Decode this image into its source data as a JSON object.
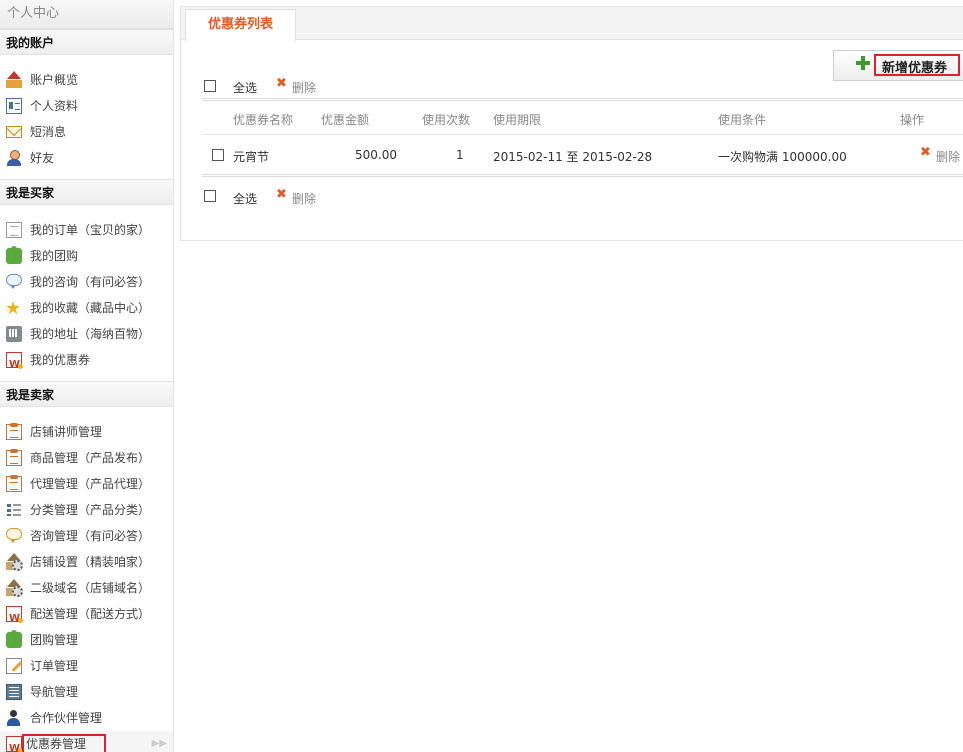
{
  "sidebar": {
    "title": "个人中心",
    "groups": [
      {
        "title": "我的账户",
        "items": [
          {
            "label": "账户概览",
            "icon": "house-icon"
          },
          {
            "label": "个人资料",
            "icon": "id-card-icon"
          },
          {
            "label": "短消息",
            "icon": "mail-icon"
          },
          {
            "label": "好友",
            "icon": "person-icon"
          }
        ]
      },
      {
        "title": "我是买家",
        "items": [
          {
            "label": "我的订单（宝贝的家）",
            "icon": "document-icon"
          },
          {
            "label": "我的团购",
            "icon": "puzzle-icon"
          },
          {
            "label": "我的咨询（有问必答）",
            "icon": "chat-bubble-icon"
          },
          {
            "label": "我的收藏（藏品中心）",
            "icon": "star-icon"
          },
          {
            "label": "我的地址（海纳百物）",
            "icon": "phone-icon"
          },
          {
            "label": "我的优惠券",
            "icon": "coupon-icon"
          }
        ]
      },
      {
        "title": "我是卖家",
        "items": [
          {
            "label": "店铺讲师管理",
            "icon": "clipboard-icon"
          },
          {
            "label": "商品管理（产品发布）",
            "icon": "clipboard-icon"
          },
          {
            "label": "代理管理（产品代理）",
            "icon": "clipboard-icon"
          },
          {
            "label": "分类管理（产品分类）",
            "icon": "list-icon"
          },
          {
            "label": "咨询管理（有问必答）",
            "icon": "chat-bubble-icon"
          },
          {
            "label": "店铺设置（精装咱家）",
            "icon": "house-settings-icon"
          },
          {
            "label": "二级域名（店铺域名）",
            "icon": "house-settings-icon"
          },
          {
            "label": "配送管理（配送方式）",
            "icon": "coupon-icon"
          },
          {
            "label": "团购管理",
            "icon": "puzzle-icon"
          },
          {
            "label": "订单管理",
            "icon": "edit-icon"
          },
          {
            "label": "导航管理",
            "icon": "grid-icon"
          },
          {
            "label": "合作伙伴管理",
            "icon": "partners-icon"
          },
          {
            "label": "优惠券管理",
            "icon": "coupon-icon",
            "active": true
          }
        ]
      }
    ]
  },
  "main": {
    "tab": "优惠券列表",
    "add_button": "新增优惠券",
    "select_all": "全选",
    "delete": "删除",
    "columns": [
      "优惠券名称",
      "优惠金额",
      "使用次数",
      "使用期限",
      "使用条件",
      "操作"
    ],
    "rows": [
      {
        "name": "元宵节",
        "amount": "500.00",
        "uses": "1",
        "period": "2015-02-11 至 2015-02-28",
        "condition": "一次购物满 100000.00",
        "action": "删除"
      }
    ]
  },
  "colors": {
    "accent": "#e65a20",
    "highlight_border": "#d9232a",
    "add_icon": "#3d9b2c"
  }
}
